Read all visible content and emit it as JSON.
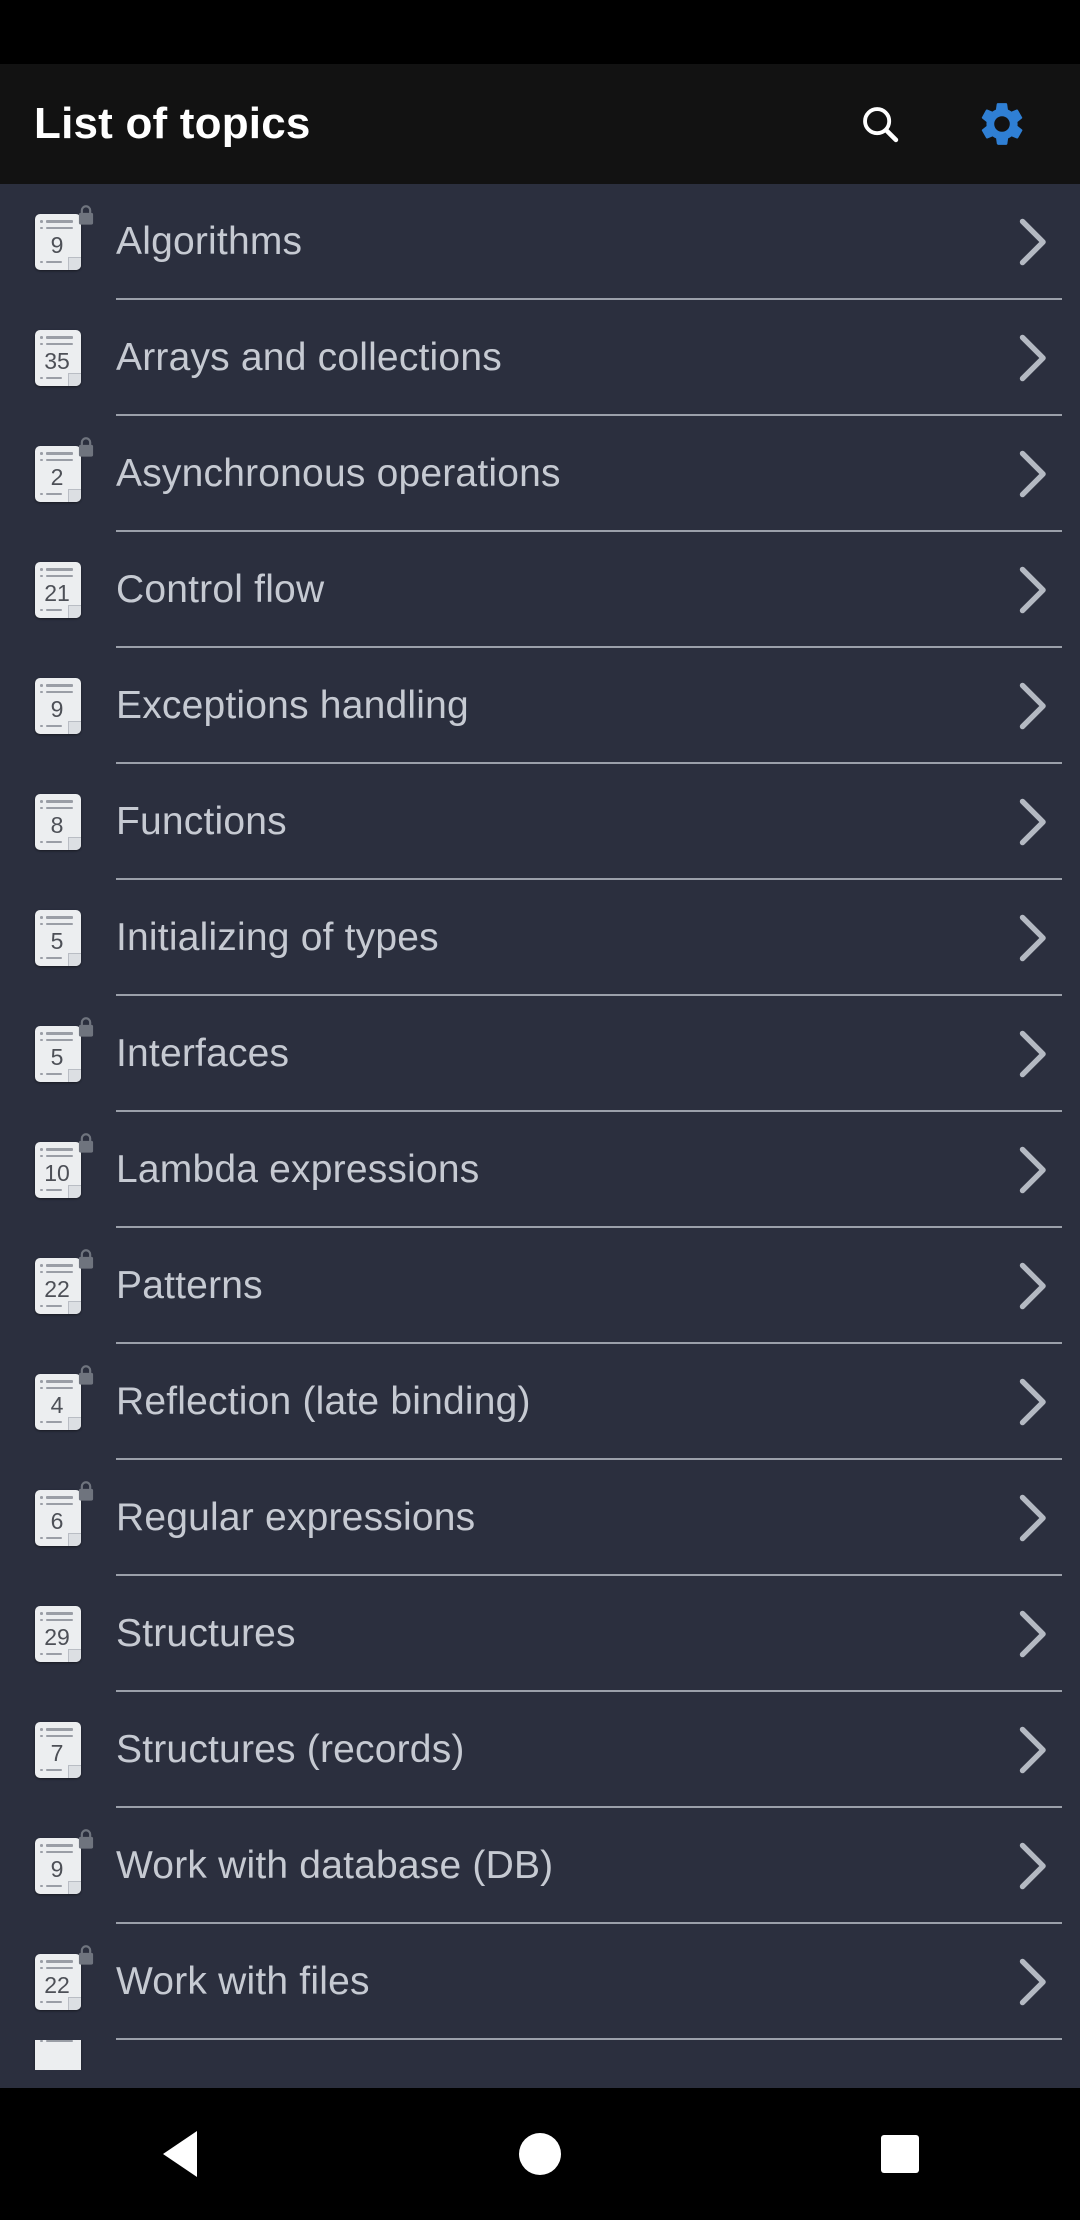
{
  "app_bar": {
    "title": "List of topics",
    "search_icon": "search-icon",
    "settings_icon": "gear-icon",
    "settings_color": "#2f7fd4",
    "background": "#121212",
    "title_color": "#ffffff"
  },
  "list": {
    "background": "#2b2f3e",
    "label_color": "#c6cad2",
    "divider_color": "#9ba0aa",
    "chevron_color": "#b4b9c2",
    "items": [
      {
        "count": "9",
        "label": "Algorithms",
        "locked": true,
        "chevron": "chevron-right-icon"
      },
      {
        "count": "35",
        "label": "Arrays and collections",
        "locked": false,
        "chevron": "chevron-right-icon"
      },
      {
        "count": "2",
        "label": "Asynchronous operations",
        "locked": true,
        "chevron": "chevron-right-icon"
      },
      {
        "count": "21",
        "label": "Control flow",
        "locked": false,
        "chevron": "chevron-right-icon"
      },
      {
        "count": "9",
        "label": "Exceptions handling",
        "locked": false,
        "chevron": "chevron-right-icon"
      },
      {
        "count": "8",
        "label": "Functions",
        "locked": false,
        "chevron": "chevron-right-icon"
      },
      {
        "count": "5",
        "label": "Initializing of types",
        "locked": false,
        "chevron": "chevron-right-icon"
      },
      {
        "count": "5",
        "label": "Interfaces",
        "locked": true,
        "chevron": "chevron-right-icon"
      },
      {
        "count": "10",
        "label": "Lambda expressions",
        "locked": true,
        "chevron": "chevron-right-icon"
      },
      {
        "count": "22",
        "label": "Patterns",
        "locked": true,
        "chevron": "chevron-right-icon"
      },
      {
        "count": "4",
        "label": "Reflection (late binding)",
        "locked": true,
        "chevron": "chevron-right-icon"
      },
      {
        "count": "6",
        "label": "Regular expressions",
        "locked": true,
        "chevron": "chevron-right-icon"
      },
      {
        "count": "29",
        "label": "Structures",
        "locked": false,
        "chevron": "chevron-right-icon"
      },
      {
        "count": "7",
        "label": "Structures (records)",
        "locked": false,
        "chevron": "chevron-right-icon"
      },
      {
        "count": "9",
        "label": "Work with database (DB)",
        "locked": true,
        "chevron": "chevron-right-icon"
      },
      {
        "count": "22",
        "label": "Work with files",
        "locked": true,
        "chevron": "chevron-right-icon"
      }
    ]
  },
  "nav_bar": {
    "back": "back-triangle-icon",
    "home": "home-circle-icon",
    "recents": "recents-square-icon",
    "background": "#000000"
  }
}
